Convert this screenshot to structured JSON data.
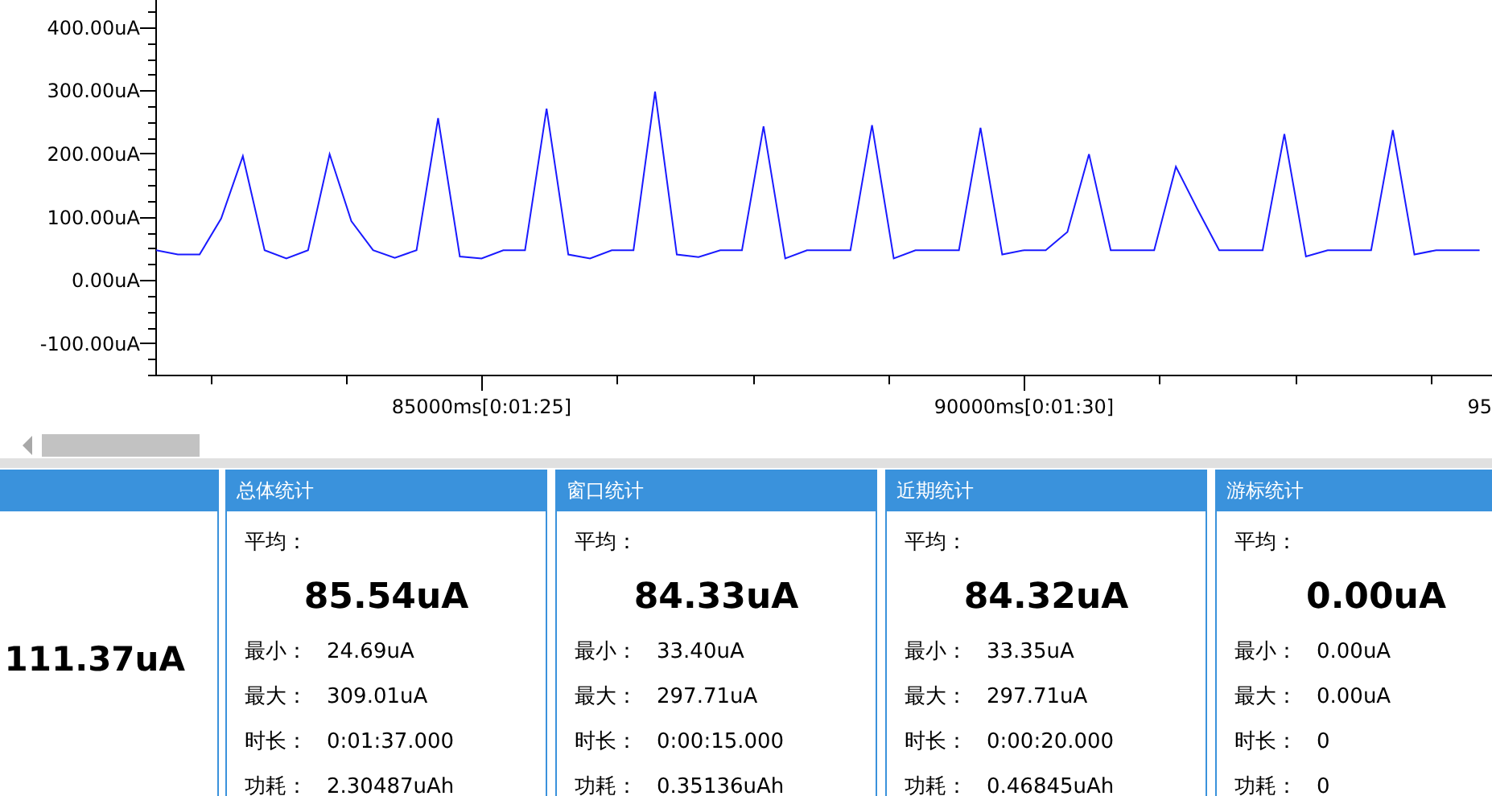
{
  "chart": {
    "chart_data": {
      "type": "line",
      "categories": [
        null,
        null,
        null,
        null,
        null,
        null,
        null,
        null,
        null,
        null,
        null,
        null,
        null,
        null,
        null,
        "85000ms[0:01:25]",
        null,
        null,
        null,
        null,
        null,
        null,
        null,
        null,
        null,
        null,
        null,
        null,
        null,
        null,
        null,
        null,
        null,
        null,
        null,
        null,
        null,
        null,
        null,
        null,
        "90000ms[0:01:30]",
        null,
        null,
        null,
        null,
        null,
        null,
        null,
        null,
        null,
        null,
        null,
        null,
        null,
        null,
        null,
        null,
        null,
        null,
        null,
        null,
        null
      ],
      "series": [
        {
          "color": "#1a1aff",
          "values": [
            47,
            40,
            40,
            97,
            196,
            47,
            34,
            47,
            199,
            93,
            47,
            35,
            47,
            256,
            37,
            34,
            47,
            47,
            271,
            40,
            34,
            47,
            47,
            298,
            40,
            36,
            47,
            47,
            243,
            34,
            47,
            47,
            47,
            245,
            34,
            47,
            47,
            47,
            241,
            40,
            47,
            47,
            76,
            199,
            47,
            47,
            47,
            179,
            112,
            47,
            47,
            47,
            231,
            37,
            47,
            47,
            47,
            237,
            40,
            47,
            47,
            47
          ]
        }
      ],
      "ylim": [
        -150,
        443
      ],
      "yticks": [
        {
          "value": -100,
          "label": "-100.00uA"
        },
        {
          "value": 0,
          "label": "0.00uA"
        },
        {
          "value": 100,
          "label": "100.00uA"
        },
        {
          "value": 200,
          "label": "200.00uA"
        },
        {
          "value": 300,
          "label": "300.00uA"
        },
        {
          "value": 400,
          "label": "400.00uA"
        }
      ]
    },
    "cut_axis_label": "95"
  },
  "panels": [
    {
      "kind": "current",
      "value": "111.37uA"
    },
    {
      "kind": "stats",
      "title": "总体统计",
      "average_label": "平均：",
      "average": "85.54uA",
      "rows": [
        {
          "label": "最小：",
          "value": "24.69uA"
        },
        {
          "label": "最大：",
          "value": "309.01uA"
        },
        {
          "label": "时长：",
          "value": "0:01:37.000"
        },
        {
          "label": "功耗：",
          "value": "2.30487uAh"
        }
      ]
    },
    {
      "kind": "stats",
      "title": "窗口统计",
      "average_label": "平均：",
      "average": "84.33uA",
      "rows": [
        {
          "label": "最小：",
          "value": "33.40uA"
        },
        {
          "label": "最大：",
          "value": "297.71uA"
        },
        {
          "label": "时长：",
          "value": "0:00:15.000"
        },
        {
          "label": "功耗：",
          "value": "0.35136uAh"
        }
      ]
    },
    {
      "kind": "stats",
      "title": "近期统计",
      "average_label": "平均：",
      "average": "84.32uA",
      "rows": [
        {
          "label": "最小：",
          "value": "33.35uA"
        },
        {
          "label": "最大：",
          "value": "297.71uA"
        },
        {
          "label": "时长：",
          "value": "0:00:20.000"
        },
        {
          "label": "功耗：",
          "value": "0.46845uAh"
        }
      ]
    },
    {
      "kind": "stats",
      "title": "游标统计",
      "average_label": "平均：",
      "average": "0.00uA",
      "rows": [
        {
          "label": "最小：",
          "value": "0.00uA"
        },
        {
          "label": "最大：",
          "value": "0.00uA"
        },
        {
          "label": "时长：",
          "value": "0"
        },
        {
          "label": "功耗：",
          "value": "0"
        }
      ]
    }
  ]
}
